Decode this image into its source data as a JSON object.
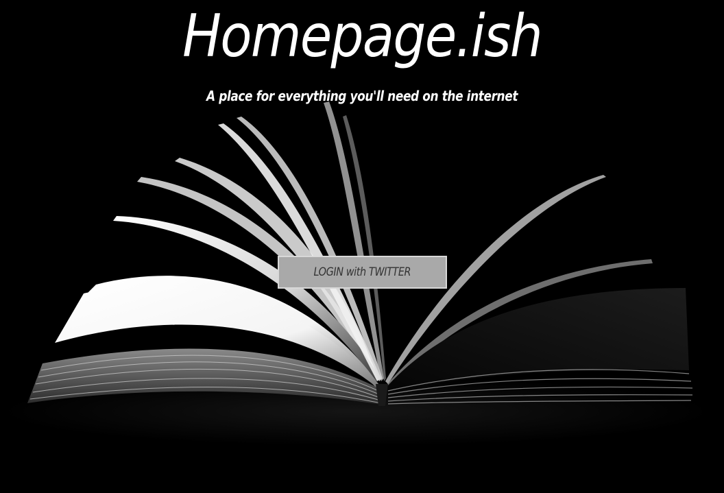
{
  "header": {
    "title": "Homepage.ish",
    "tagline": "A place for everything you'll need on the internet"
  },
  "hero": {
    "image": "open-book-photo",
    "login_button_label": "LOGIN with TWITTER"
  },
  "colors": {
    "background": "#000000",
    "text": "#ffffff",
    "button_bg": "#a9a9a9",
    "button_border": "#d8d8d8",
    "button_text": "#333333"
  }
}
